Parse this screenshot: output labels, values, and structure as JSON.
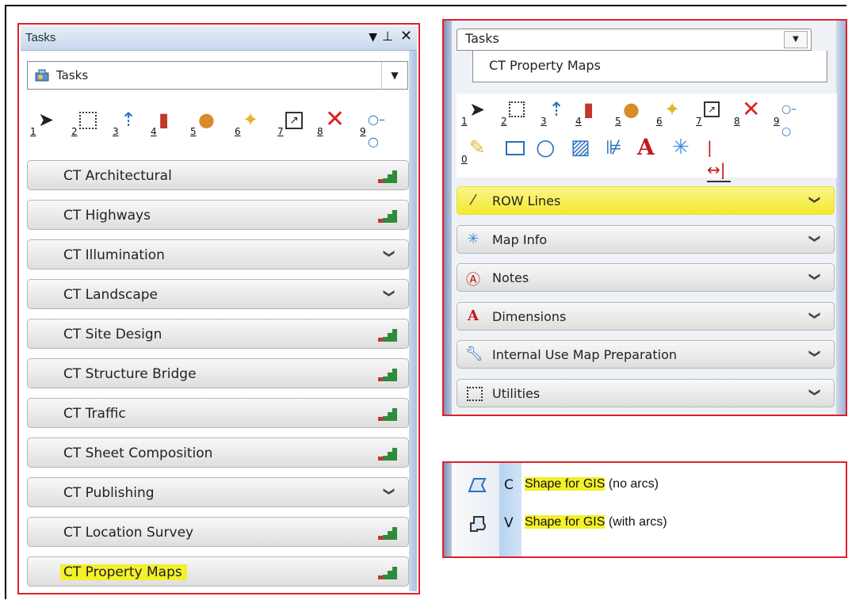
{
  "left_panel": {
    "title": "Tasks",
    "controls": {
      "dropdown": "▼",
      "pin": "⊥",
      "close": "✕"
    },
    "combo": {
      "value": "Tasks"
    },
    "toolbar_numbers": [
      "1",
      "2",
      "3",
      "4",
      "5",
      "6",
      "7",
      "8",
      "9"
    ],
    "tasks": [
      {
        "label": "CT Architectural",
        "indicator": "stairs"
      },
      {
        "label": "CT Highways",
        "indicator": "stairs"
      },
      {
        "label": "CT Illumination",
        "indicator": "chevron"
      },
      {
        "label": "CT Landscape",
        "indicator": "chevron"
      },
      {
        "label": "CT Site Design",
        "indicator": "stairs"
      },
      {
        "label": "CT Structure Bridge",
        "indicator": "stairs"
      },
      {
        "label": "CT Traffic",
        "indicator": "stairs"
      },
      {
        "label": "CT Sheet Composition",
        "indicator": "stairs"
      },
      {
        "label": "CT Publishing",
        "indicator": "chevron"
      },
      {
        "label": "CT Location Survey",
        "indicator": "stairs"
      },
      {
        "label": "CT Property Maps",
        "indicator": "stairs",
        "highlighted": true
      }
    ]
  },
  "right_panel": {
    "combo": {
      "value": "Tasks"
    },
    "tab": "CT Property Maps",
    "toolbar_row1_numbers": [
      "1",
      "2",
      "3",
      "4",
      "5",
      "6",
      "7",
      "8",
      "9"
    ],
    "toolbar_row2_numbers": [
      "0"
    ],
    "rows": [
      {
        "label": "ROW Lines",
        "icon": "line-icon",
        "highlighted": true
      },
      {
        "label": "Map Info",
        "icon": "starburst-icon"
      },
      {
        "label": "Notes",
        "icon": "note-icon"
      },
      {
        "label": "Dimensions",
        "icon": "text-a-icon"
      },
      {
        "label": "Internal Use Map Preparation",
        "icon": "wrench-icon"
      },
      {
        "label": "Utilities",
        "icon": "dotted-rect-icon"
      }
    ]
  },
  "shape_panel": {
    "items": [
      {
        "key": "C",
        "highlight": "Shape for GIS",
        "rest": " (no arcs)"
      },
      {
        "key": "V",
        "highlight": "Shape for GIS",
        "rest": " (with arcs)"
      }
    ]
  },
  "colors": {
    "highlight": "#f4f02a",
    "frame": "#e0202c"
  }
}
